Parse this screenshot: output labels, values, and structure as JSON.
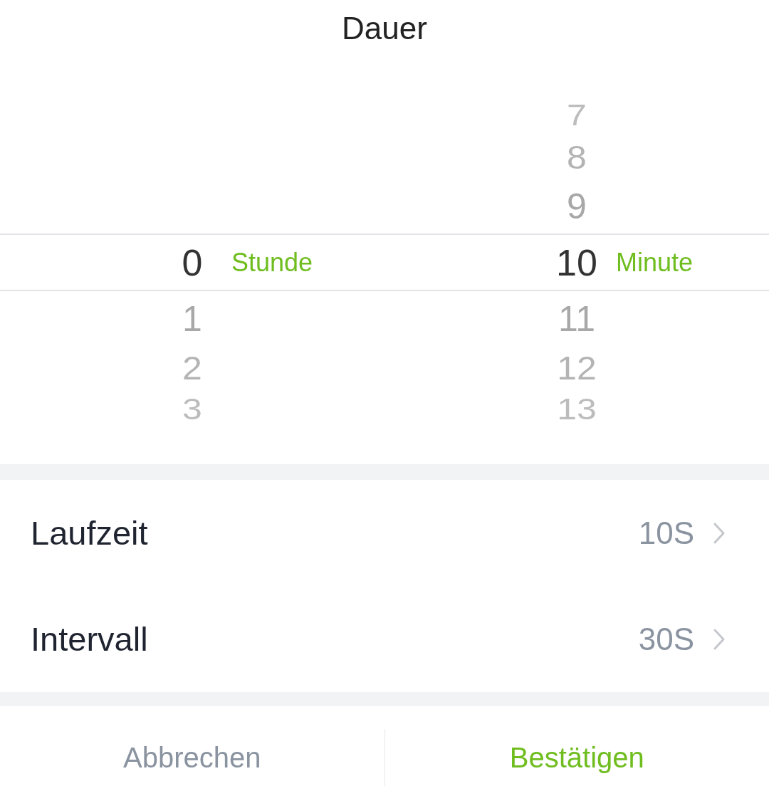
{
  "dialog": {
    "title": "Dauer"
  },
  "picker": {
    "columns": [
      {
        "unit": "Stunde",
        "items": [
          {
            "value": "0",
            "selected": true
          },
          {
            "value": "1",
            "selected": false
          },
          {
            "value": "2",
            "selected": false
          },
          {
            "value": "3",
            "selected": false
          }
        ]
      },
      {
        "unit": "Minute",
        "items": [
          {
            "value": "7",
            "selected": false
          },
          {
            "value": "8",
            "selected": false
          },
          {
            "value": "9",
            "selected": false
          },
          {
            "value": "10",
            "selected": true
          },
          {
            "value": "11",
            "selected": false
          },
          {
            "value": "12",
            "selected": false
          },
          {
            "value": "13",
            "selected": false
          }
        ]
      }
    ]
  },
  "settings": [
    {
      "label": "Laufzeit",
      "value": "10S"
    },
    {
      "label": "Intervall",
      "value": "30S"
    }
  ],
  "buttons": [
    {
      "label": "Abbrechen",
      "kind": "secondary"
    },
    {
      "label": "Bestätigen",
      "kind": "primary"
    }
  ]
}
